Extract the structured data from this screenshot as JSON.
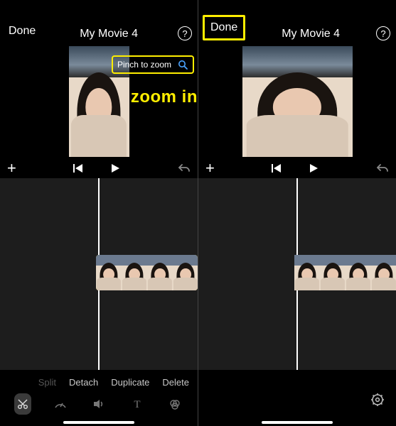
{
  "left": {
    "header": {
      "done": "Done",
      "title": "My Movie 4",
      "help": "?"
    },
    "pinch_label": "Pinch to zoom",
    "zoom_overlay": "zoom in",
    "edit": {
      "split": "Split",
      "detach": "Detach",
      "duplicate": "Duplicate",
      "delete": "Delete"
    }
  },
  "right": {
    "header": {
      "done": "Done",
      "title": "My Movie 4",
      "help": "?"
    }
  },
  "icons": {
    "help": "?",
    "plus": "+"
  },
  "colors": {
    "highlight": "#ffee00",
    "clip_select": "#ffd400"
  }
}
